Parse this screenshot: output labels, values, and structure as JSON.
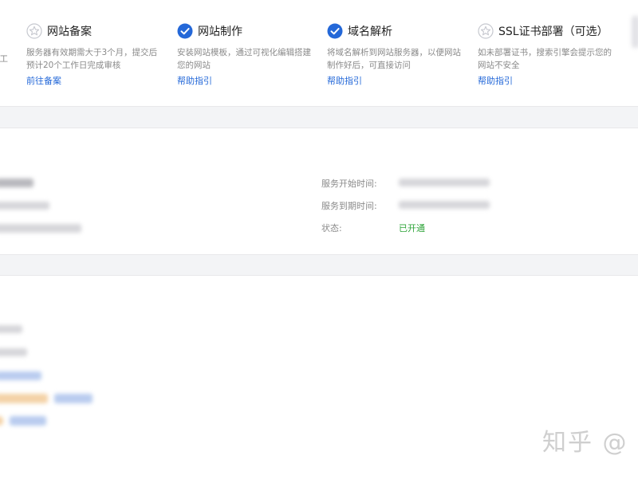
{
  "steps": [
    {
      "icon": "star-outline-icon",
      "title": "",
      "description": "工",
      "link": ""
    },
    {
      "icon": "star-outline-icon",
      "title": "网站备案",
      "description": "服务器有效期需大于3个月，提交后预计20个工作日完成审核",
      "link": "前往备案"
    },
    {
      "icon": "check-circle-icon",
      "title": "网站制作",
      "description": "安装网站模板，通过可视化编辑搭建您的网站",
      "link": "帮助指引"
    },
    {
      "icon": "check-circle-icon",
      "title": "域名解析",
      "description": "将域名解析到网站服务器，以便网站制作好后，可直接访问",
      "link": "帮助指引"
    },
    {
      "icon": "star-outline-icon",
      "title": "SSL证书部署（可选）",
      "description": "如未部署证书，搜索引擎会提示您的网站不安全",
      "link": "帮助指引"
    }
  ],
  "service_info": {
    "start_label": "服务开始时间:",
    "end_label": "服务到期时间:",
    "status_label": "状态:",
    "status_value": "已开通"
  },
  "colors": {
    "accent": "#2468d8",
    "success": "#2fa43a",
    "page_bg": "#f3f4f6"
  },
  "watermark": "知乎 @"
}
